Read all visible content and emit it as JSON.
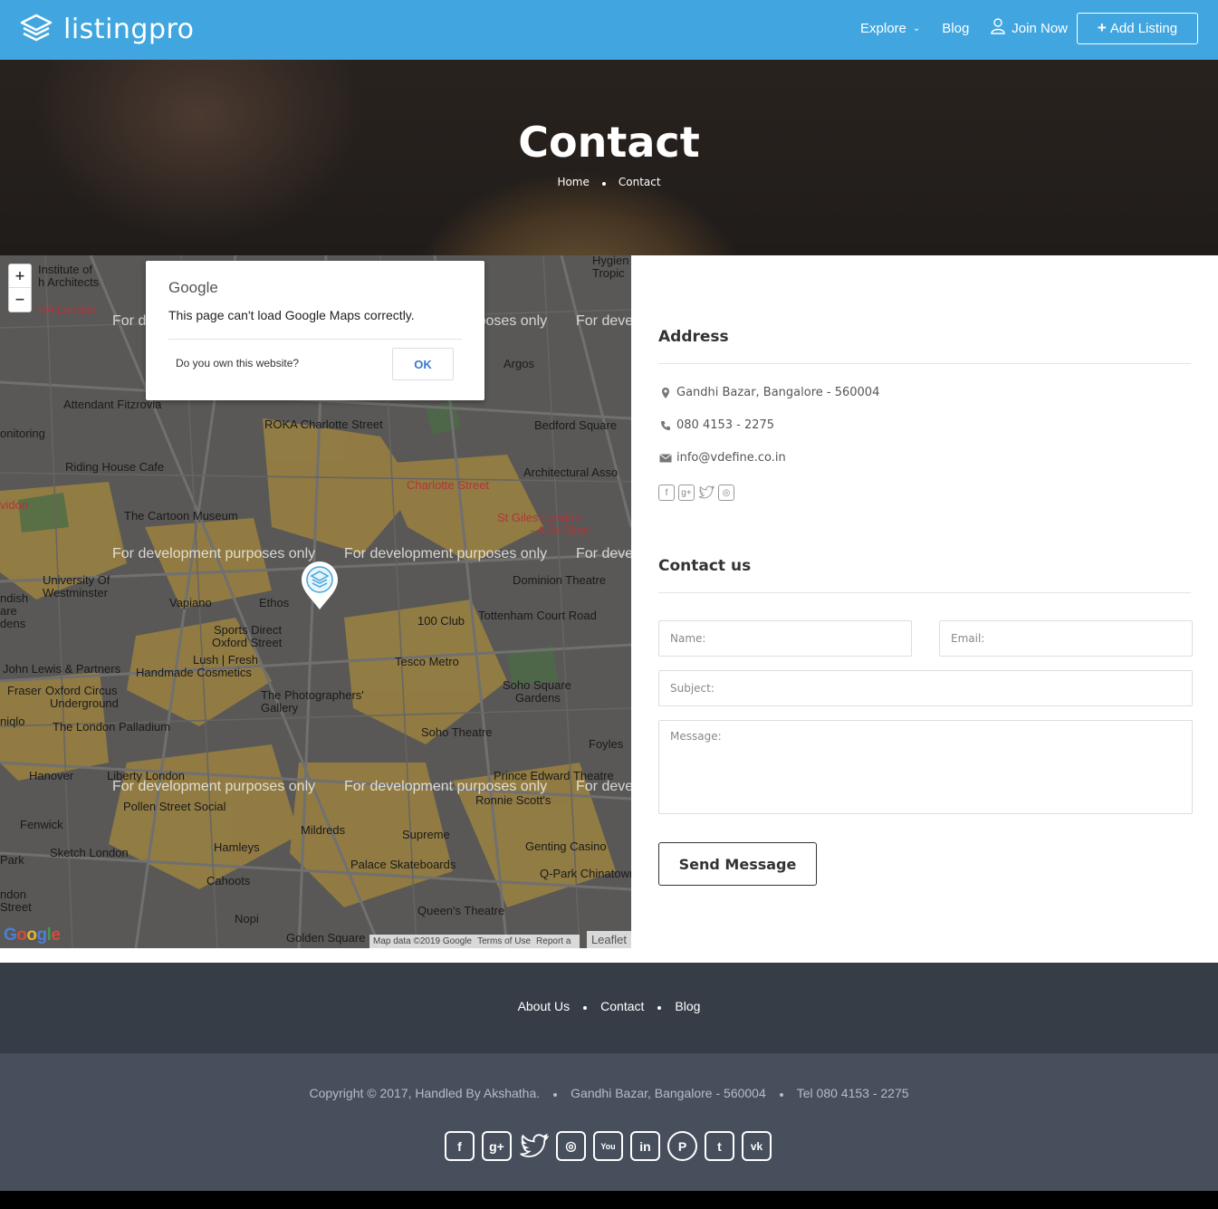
{
  "header": {
    "logo_text": "listingpro",
    "nav": {
      "explore": "Explore",
      "blog": "Blog",
      "join": "Join Now",
      "add_listing": "Add Listing"
    }
  },
  "hero": {
    "title": "Contact",
    "breadcrumb": [
      "Home",
      "Contact"
    ]
  },
  "map": {
    "zoom_in": "+",
    "zoom_out": "−",
    "dialog": {
      "brand": "Google",
      "message": "This page can't load Google Maps correctly.",
      "own_question": "Do you own this website?",
      "ok": "OK"
    },
    "watermark": "For development purposes only",
    "labels": [
      "Institute of",
      "h Architects",
      "HA London",
      "Hygien",
      "Tropic",
      "Argos",
      "Attendant Fitzrovia",
      "ROKA Charlotte Street",
      "Bedford Square",
      "Riding House Cafe",
      "Charlotte Street",
      "Architectural Asso",
      "The Cartoon Museum",
      "St Giles London",
      "- A St Giles",
      "University Of",
      "Westminster",
      "Vapiano",
      "Ethos",
      "Dominion Theatre",
      "100 Club",
      "Tottenham Court Road",
      "Sports Direct",
      "Oxford Street",
      "Lush | Fresh",
      "Tesco Metro",
      "John Lewis & Partners",
      "Handmade Cosmetics",
      "Oxford Circus",
      "Underground",
      "The Photographers'",
      "Gallery",
      "Soho Square",
      "Gardens",
      "The London Palladium",
      "Soho Theatre",
      "Foyles",
      "Hanover",
      "Liberty London",
      "Prince Edward Theatre",
      "Ronnie Scott's",
      "Pollen Street Social",
      "Fenwick",
      "Mildreds",
      "Supreme",
      "Sketch London",
      "Hamleys",
      "Genting Casino",
      "Palace Skateboards",
      "Cahoots",
      "Q-Park Chinatown",
      "Queen's Theatre",
      "Nopi",
      "Golden Square",
      "onitoring",
      "vidon",
      "ndish",
      "are",
      "dens",
      "Park",
      "ndon",
      "Street",
      "niqlo",
      "Fraser"
    ],
    "google_logo": "Google",
    "attribution": [
      "Map data ©2019 Google",
      "Terms of Use",
      "Report a"
    ],
    "leaflet": "Leaflet"
  },
  "address": {
    "title": "Address",
    "location": "Gandhi Bazar, Bangalore - 560004",
    "phone": "080 4153 - 2275",
    "email": "info@vdefine.co.in",
    "socials": [
      "facebook-icon",
      "google-plus-icon",
      "twitter-icon",
      "instagram-icon"
    ]
  },
  "contact": {
    "title": "Contact us",
    "name_placeholder": "Name:",
    "email_placeholder": "Email:",
    "subject_placeholder": "Subject:",
    "message_placeholder": "Message:",
    "send": "Send Message"
  },
  "footer": {
    "links": [
      "About Us",
      "Contact",
      "Blog"
    ],
    "copyright": "Copyright © 2017, Handled By Akshatha.",
    "address": "Gandhi Bazar, Bangalore - 560004",
    "tel": "Tel 080 4153 - 2275",
    "socials": [
      "facebook-icon",
      "google-plus-icon",
      "twitter-icon",
      "instagram-icon",
      "youtube-icon",
      "linkedin-icon",
      "pinterest-icon",
      "tumblr-icon",
      "vk-icon"
    ]
  },
  "colors": {
    "header": "#41a6df",
    "footer_top": "#363d47",
    "footer_bottom": "#474f5d"
  }
}
